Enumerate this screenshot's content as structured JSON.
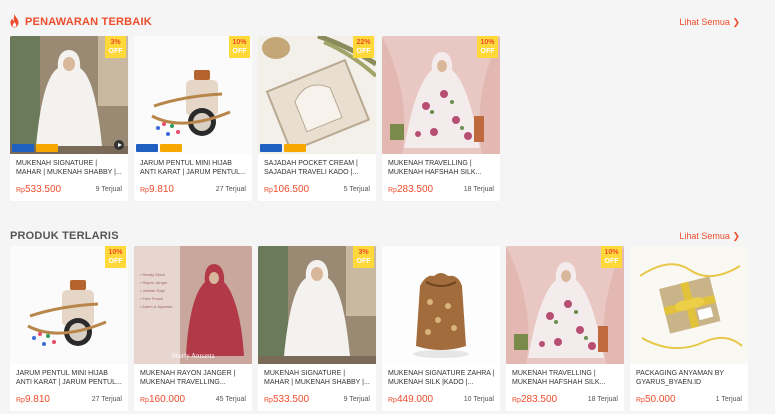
{
  "colors": {
    "accent": "#ee4d2d",
    "discount_badge": "#ffd839",
    "page_bg": "#f5f5f5"
  },
  "sections": [
    {
      "title": "PENAWARAN TERBAIK",
      "title_icon": "flame-icon",
      "see_all": "Lihat Semua",
      "products": [
        {
          "name": "MUKENAH SIGNATURE | MAHAR | MUKENAH SHABBY |...",
          "price": "533.500",
          "sold": "9 Terjual",
          "discount": "3%",
          "off": "OFF",
          "promo": true,
          "video": true,
          "image": "mukena-white"
        },
        {
          "name": "JARUM PENTUL MINI HIJAB ANTI KARAT | JARUM PENTUL...",
          "price": "9.810",
          "sold": "27 Terjual",
          "discount": "10%",
          "off": "OFF",
          "promo": true,
          "video": false,
          "image": "pins-jar"
        },
        {
          "name": "SAJADAH POCKET CREAM | SAJADAH TRAVELI KADO |...",
          "price": "106.500",
          "sold": "5 Terjual",
          "discount": "22%",
          "off": "OFF",
          "promo": true,
          "video": false,
          "image": "prayer-mat"
        },
        {
          "name": "MUKENAH TRAVELLING | MUKENAH HAFSHAH SILK...",
          "price": "283.500",
          "sold": "18 Terjual",
          "discount": "10%",
          "off": "OFF",
          "promo": false,
          "video": false,
          "image": "mukena-floral"
        }
      ]
    },
    {
      "title": "PRODUK TERLARIS",
      "see_all": "Lihat Semua",
      "products": [
        {
          "name": "JARUM PENTUL MINI HIJAB ANTI KARAT | JARUM PENTUL...",
          "price": "9.810",
          "sold": "27 Terjual",
          "discount": "10%",
          "off": "OFF",
          "image": "pins-jar"
        },
        {
          "name": "MUKENAH RAYON JANGER | MUKENAH TRAVELLING...",
          "price": "160.000",
          "sold": "45 Terjual",
          "discount": "",
          "off": "",
          "image": "mukena-red",
          "caption": "Sherly Annanta"
        },
        {
          "name": "MUKENAH SIGNATURE | MAHAR | MUKENAH SHABBY |...",
          "price": "533.500",
          "sold": "9 Terjual",
          "discount": "3%",
          "off": "OFF",
          "image": "mukena-white"
        },
        {
          "name": "MUKENAH SIGNATURE ZAHRA | Mukenah SILK |KADO |...",
          "price": "449.000",
          "sold": "10 Terjual",
          "discount": "",
          "off": "",
          "image": "pouch"
        },
        {
          "name": "MUKENAH TRAVELLING | MUKENAH HAFSHAH SILK...",
          "price": "283.500",
          "sold": "18 Terjual",
          "discount": "10%",
          "off": "OFF",
          "image": "mukena-floral"
        },
        {
          "name": "PACKAGING ANYAMAN BY GYARUS_BYAEN.ID",
          "price": "50.000",
          "sold": "1 Terjual",
          "discount": "",
          "off": "",
          "image": "gift-box"
        }
      ]
    }
  ],
  "currency": "Rp"
}
